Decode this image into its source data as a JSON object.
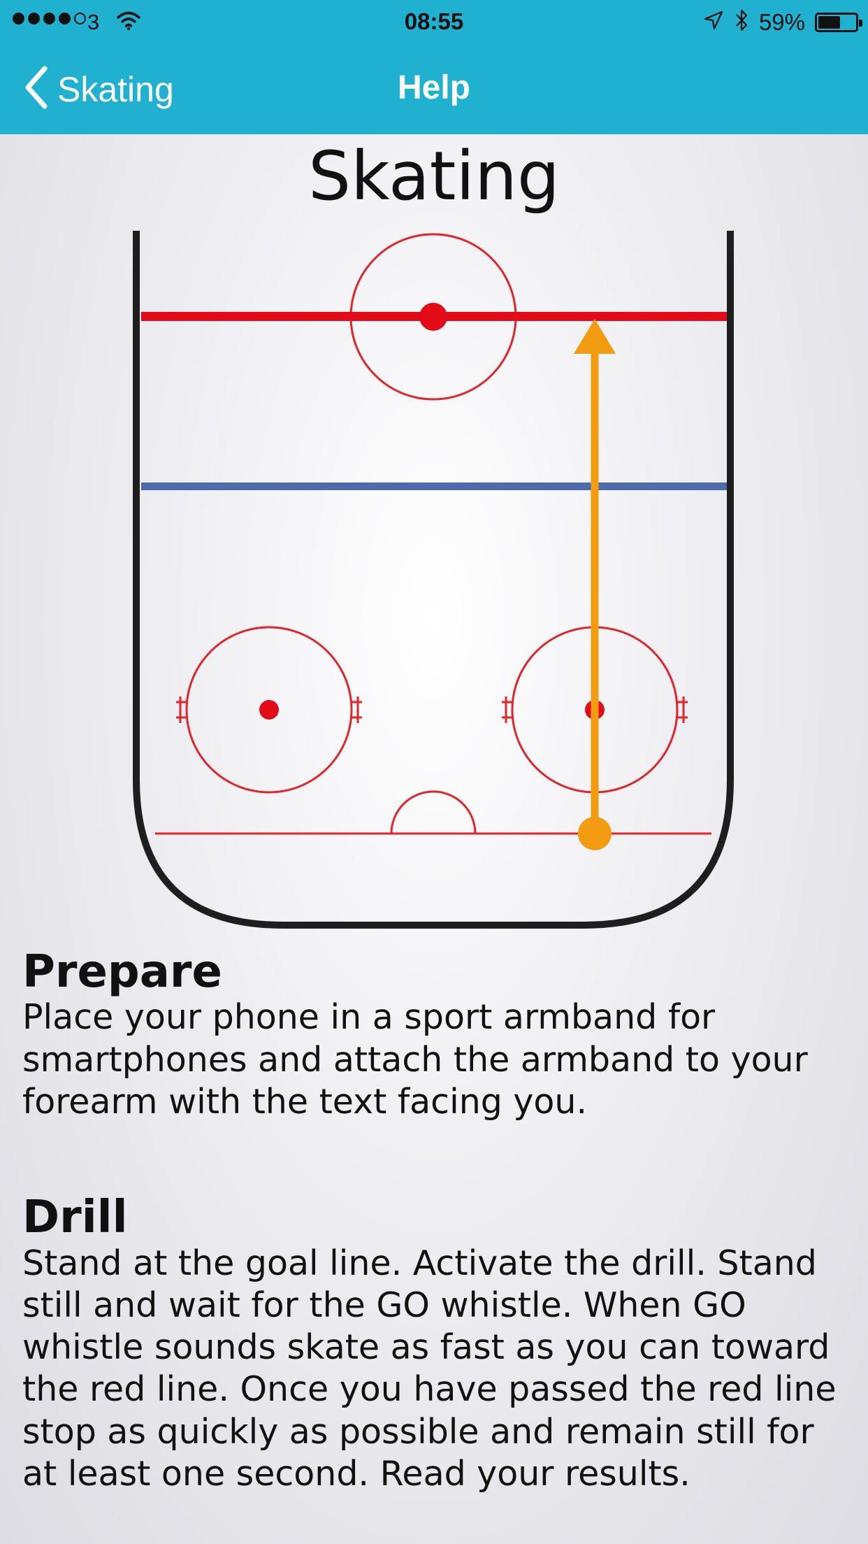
{
  "status_bar": {
    "carrier": "3",
    "time": "08:55",
    "battery_percent": "59%",
    "battery_level": 0.59,
    "signal_bars_filled": 4,
    "signal_bars_total": 5,
    "icons": [
      "wifi-icon",
      "location-icon",
      "bluetooth-icon",
      "battery-icon"
    ]
  },
  "nav": {
    "back_label": "Skating",
    "title": "Help"
  },
  "page": {
    "title": "Skating"
  },
  "diagram": {
    "description_free": true,
    "colors": {
      "boards": "#1e1e1e",
      "red_line": "#e30b18",
      "blue_line": "#4d6aad",
      "circles": "#e3242b",
      "path_arrow": "#f39c12"
    }
  },
  "sections": {
    "prepare": {
      "heading": "Prepare",
      "body": "Place your phone in a sport armband for smartphones and attach the armband to your forearm with the text facing you."
    },
    "drill": {
      "heading": "Drill",
      "body": "Stand at the goal line. Activate the drill.  Stand still and wait for the GO whistle. When GO whistle sounds skate as fast as you can toward the red line. Once you have passed the red line stop as quickly as possible and remain still for at least one second.  Read your results."
    }
  }
}
